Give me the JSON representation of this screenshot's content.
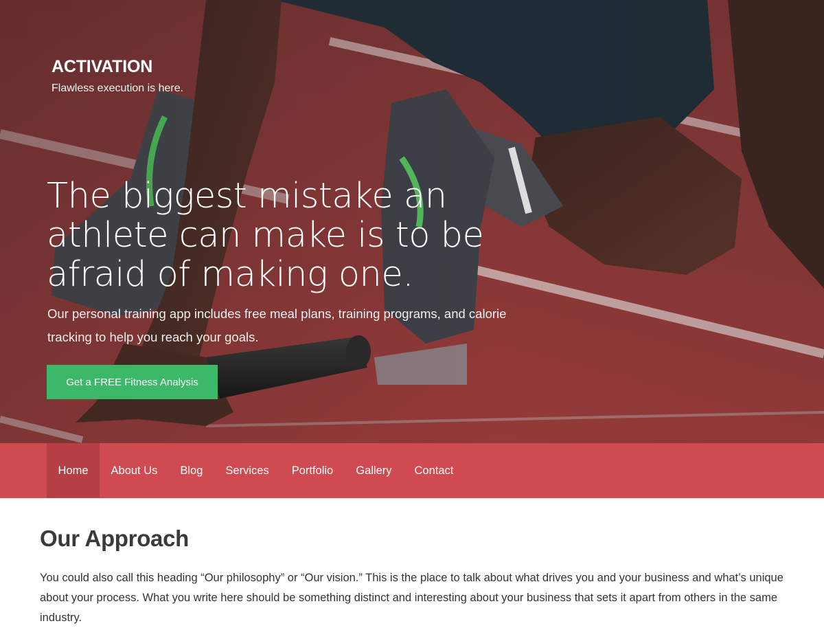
{
  "site": {
    "title": "ACTIVATION",
    "tagline": "Flawless execution is here."
  },
  "hero": {
    "headline": "The biggest mistake an athlete can make is to be afraid of making one.",
    "subtext": "Our personal training app includes free meal plans, training programs, and calorie tracking to help you reach your goals.",
    "cta_label": "Get a FREE Fitness Analysis",
    "colors": {
      "track": "#a63a37",
      "cta": "#3cb869"
    }
  },
  "nav": {
    "items": [
      {
        "label": "Home",
        "active": true
      },
      {
        "label": "About Us"
      },
      {
        "label": "Blog"
      },
      {
        "label": "Services"
      },
      {
        "label": "Portfolio"
      },
      {
        "label": "Gallery"
      },
      {
        "label": "Contact"
      }
    ],
    "colors": {
      "bar": "#cf4b51",
      "active": "#b63f45"
    }
  },
  "approach": {
    "title": "Our Approach",
    "body": "You could also call this heading “Our philosophy” or “Our vision.” This is the place to talk about what drives you and your business and what’s unique about your process. What you write here should be something distinct and interesting about your business that sets it apart from others in the same industry."
  }
}
